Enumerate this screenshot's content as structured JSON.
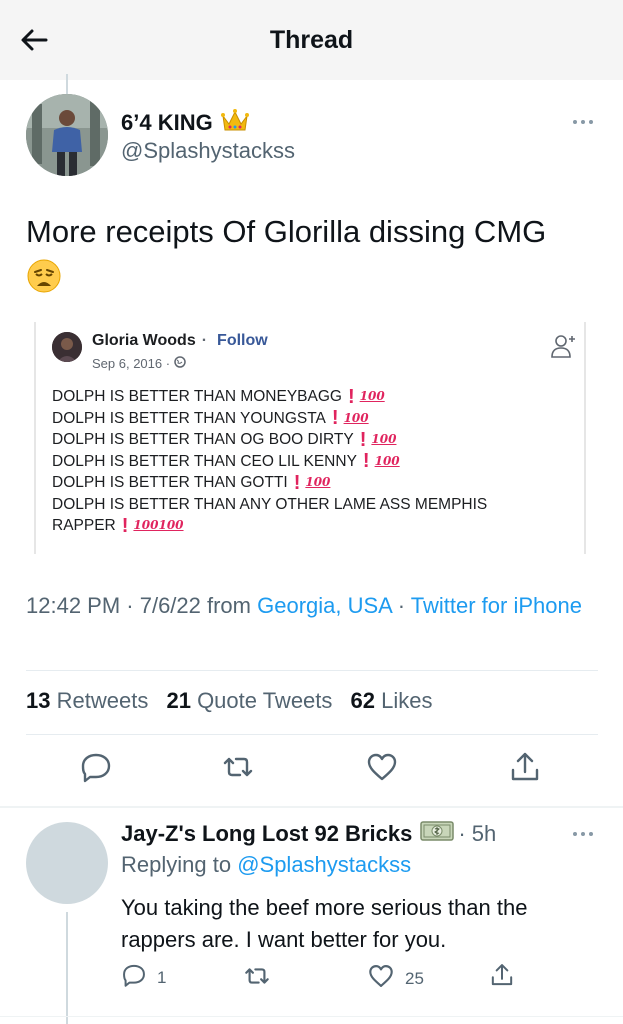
{
  "header": {
    "title": "Thread"
  },
  "tweet": {
    "display_name": "6’4 KING",
    "name_emoji": "crown-emoji",
    "handle": "@Splashystackss",
    "text": "More receipts Of Glorilla dissing CMG",
    "text_emoji": "😩",
    "timestamp": "12:42 PM · 7/6/22 from ",
    "location": "Georgia, USA",
    "separator": " · ",
    "source": "Twitter for iPhone",
    "stats": {
      "retweets_count": "13",
      "retweets_label": "Retweets",
      "quotes_count": "21",
      "quotes_label": "Quote Tweets",
      "likes_count": "62",
      "likes_label": "Likes"
    }
  },
  "embedded_post": {
    "author": "Gloria Woods",
    "dot": "·",
    "follow_label": "Follow",
    "date": "Sep 6, 2016 ·",
    "lines": [
      {
        "text": "DOLPH IS BETTER THAN MONEYBAGG",
        "hundred": "100"
      },
      {
        "text": "DOLPH IS BETTER THAN YOUNGSTA",
        "hundred": "100"
      },
      {
        "text": "DOLPH IS BETTER THAN OG BOO DIRTY",
        "hundred": "100"
      },
      {
        "text": "DOLPH IS BETTER THAN CEO LIL KENNY",
        "hundred": "100"
      },
      {
        "text": "DOLPH IS BETTER THAN GOTTI",
        "hundred": "100"
      },
      {
        "text": "DOLPH IS BETTER THAN ANY OTHER LAME ASS MEMPHIS",
        "hundred": ""
      },
      {
        "text": "RAPPER",
        "hundred": "100100"
      }
    ],
    "excl": "!"
  },
  "reply": {
    "display_name": "Jay-Z's Long Lost 92 Bricks",
    "name_emoji": "money-emoji",
    "time": "· 5h",
    "replying_prefix": "Replying to ",
    "replying_handle": "@Splashystackss",
    "text": "You taking the beef more serious than the rappers are.  I want better for you.",
    "reply_count": "1",
    "like_count": "25"
  },
  "colors": {
    "link": "#1d9bf0",
    "secondary_text": "#536471",
    "fb_link": "#385898",
    "emoji_red": "#e0245e"
  }
}
